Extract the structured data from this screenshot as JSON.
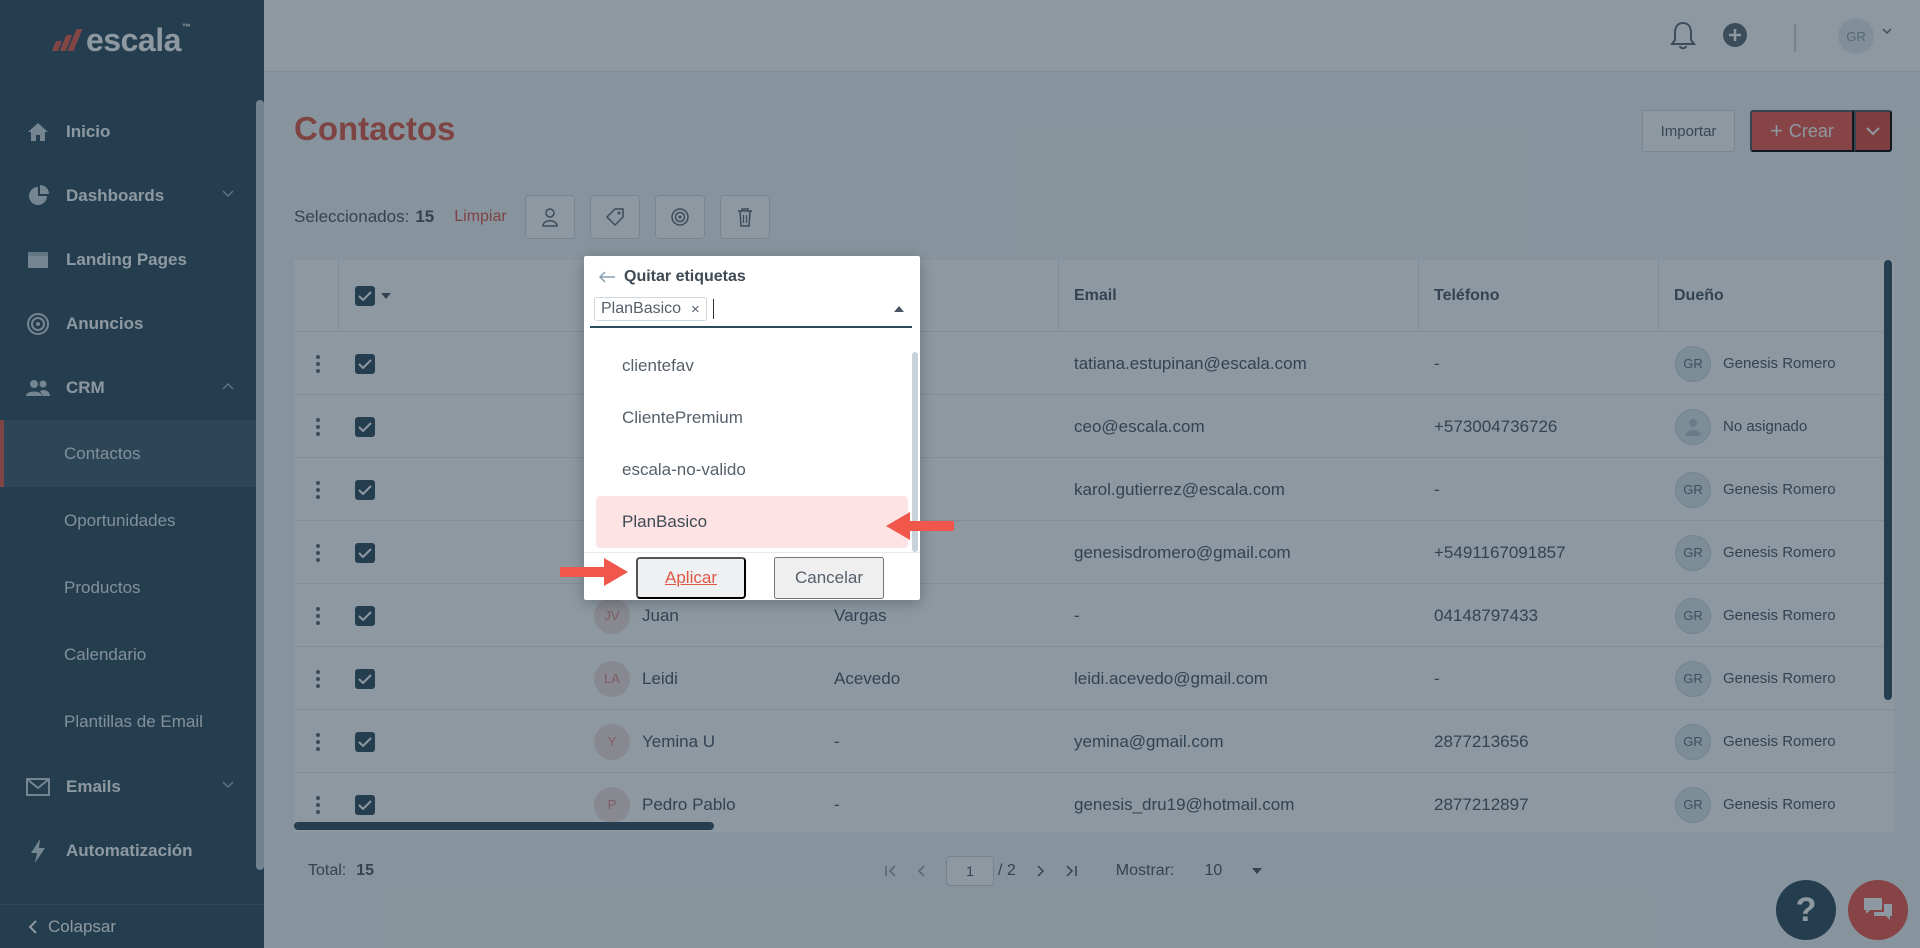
{
  "app": {
    "brand": "escala",
    "brand_tm": "™"
  },
  "sidebar": {
    "items": [
      {
        "label": "Inicio",
        "icon": "home-icon"
      },
      {
        "label": "Dashboards",
        "icon": "pie-chart-icon",
        "has_chevron": true
      },
      {
        "label": "Landing Pages",
        "icon": "browser-window-icon"
      },
      {
        "label": "Anuncios",
        "icon": "target-icon"
      },
      {
        "label": "CRM",
        "icon": "users-icon",
        "expanded": true
      }
    ],
    "crm_sub": [
      "Contactos",
      "Oportunidades",
      "Productos",
      "Calendario",
      "Plantillas de Email"
    ],
    "active_sub": "Contactos",
    "items_after": [
      {
        "label": "Emails",
        "icon": "envelope-icon"
      },
      {
        "label": "Automatización",
        "icon": "lightning-icon"
      }
    ],
    "collapse_label": "Colapsar"
  },
  "topbar": {
    "user_initials": "GR"
  },
  "page": {
    "title": "Contactos",
    "import_label": "Importar",
    "create_label": "Crear"
  },
  "selection": {
    "label": "Seleccionados:",
    "count": "15",
    "clear_label": "Limpiar"
  },
  "table": {
    "headers": {
      "email": "Email",
      "phone": "Teléfono",
      "owner": "Dueño"
    },
    "rows": [
      {
        "initials": "",
        "first": "",
        "last": "",
        "email": "tatiana.estupinan@escala.com",
        "phone": "-",
        "owner_initials": "GR",
        "owner": "Genesis Romero"
      },
      {
        "initials": "",
        "first": "",
        "last": "",
        "email": "ceo@escala.com",
        "phone": "+573004736726",
        "owner_initials": "",
        "owner": "No asignado"
      },
      {
        "initials": "",
        "first": "",
        "last": "",
        "email": "karol.gutierrez@escala.com",
        "phone": "-",
        "owner_initials": "GR",
        "owner": "Genesis Romero"
      },
      {
        "initials": "",
        "first": "",
        "last": "",
        "email": "genesisdromero@gmail.com",
        "phone": "+5491167091857",
        "owner_initials": "GR",
        "owner": "Genesis Romero"
      },
      {
        "initials": "JV",
        "first": "Juan",
        "last": "Vargas",
        "email": "-",
        "phone": "04148797433",
        "owner_initials": "GR",
        "owner": "Genesis Romero"
      },
      {
        "initials": "LA",
        "first": "Leidi",
        "last": "Acevedo",
        "email": "leidi.acevedo@gmail.com",
        "phone": "-",
        "owner_initials": "GR",
        "owner": "Genesis Romero"
      },
      {
        "initials": "Y",
        "first": "Yemina U",
        "last": "-",
        "email": "yemina@gmail.com",
        "phone": "2877213656",
        "owner_initials": "GR",
        "owner": "Genesis Romero"
      },
      {
        "initials": "P",
        "first": "Pedro Pablo",
        "last": "-",
        "email": "genesis_dru19@hotmail.com",
        "phone": "2877212897",
        "owner_initials": "GR",
        "owner": "Genesis Romero"
      }
    ]
  },
  "footer": {
    "total_label": "Total:",
    "total": "15",
    "page": "1",
    "of": "/ 2",
    "show_label": "Mostrar:",
    "show_value": "10"
  },
  "popup": {
    "title": "Quitar etiquetas",
    "chip": "PlanBasico",
    "chip_remove": "×",
    "options": [
      "clientefav",
      "ClientePremium",
      "escala-no-valido",
      "PlanBasico"
    ],
    "selected": "PlanBasico",
    "apply_label": "Aplicar",
    "cancel_label": "Cancelar"
  },
  "help_label": "?",
  "colors": {
    "brand": "#e8584a",
    "sidebar": "#2c4a5e",
    "accent_red": "#f0574a"
  }
}
